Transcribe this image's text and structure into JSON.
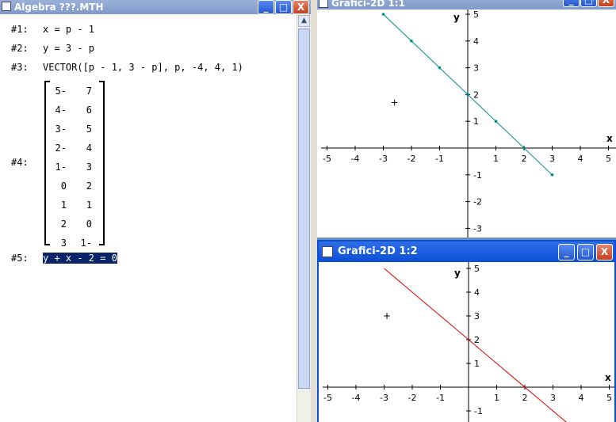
{
  "algebra": {
    "title": "Algebra ???.MTH",
    "lines": [
      {
        "label": "#1:",
        "expr": "x = p - 1"
      },
      {
        "label": "#2:",
        "expr": "y = 3 - p"
      },
      {
        "label": "#3:",
        "expr": "VECTOR([p - 1, 3 - p], p, -4, 4, 1)"
      },
      {
        "label": "#4:"
      },
      {
        "label": "#5:",
        "expr": "y + x - 2 = 0"
      }
    ],
    "matrix": [
      [
        "-5",
        "7"
      ],
      [
        "-4",
        "6"
      ],
      [
        "-3",
        "5"
      ],
      [
        "-2",
        "4"
      ],
      [
        "-1",
        "3"
      ],
      [
        "0",
        "2"
      ],
      [
        "1",
        "1"
      ],
      [
        "2",
        "0"
      ],
      [
        "3",
        "-1"
      ]
    ]
  },
  "graph1": {
    "title": "Grafici-2D 1:1",
    "axis_x_label": "x",
    "axis_y_label": "y",
    "x_ticks": [
      "-5",
      "-4",
      "-3",
      "-2",
      "-1",
      "1",
      "2",
      "3",
      "4",
      "5"
    ],
    "y_ticks": [
      "5",
      "4",
      "3",
      "2",
      "1",
      "-1",
      "-2",
      "-3"
    ],
    "cursor_mark": "+",
    "line_color": "#008b8b",
    "points": [
      [
        -3,
        5
      ],
      [
        -2,
        4
      ],
      [
        -1,
        3
      ],
      [
        0,
        2
      ],
      [
        1,
        1
      ],
      [
        2,
        0
      ],
      [
        3,
        -1
      ]
    ]
  },
  "graph2": {
    "title": "Grafici-2D 1:2",
    "axis_x_label": "x",
    "axis_y_label": "y",
    "x_ticks": [
      "-5",
      "-4",
      "-3",
      "-2",
      "-1",
      "1",
      "2",
      "3",
      "4",
      "5"
    ],
    "y_ticks": [
      "5",
      "4",
      "3",
      "2",
      "1",
      "-1"
    ],
    "cursor_mark": "+",
    "line_color": "#e00000"
  },
  "window_buttons": {
    "minimize": "_",
    "maximize": "□",
    "close": "X"
  }
}
